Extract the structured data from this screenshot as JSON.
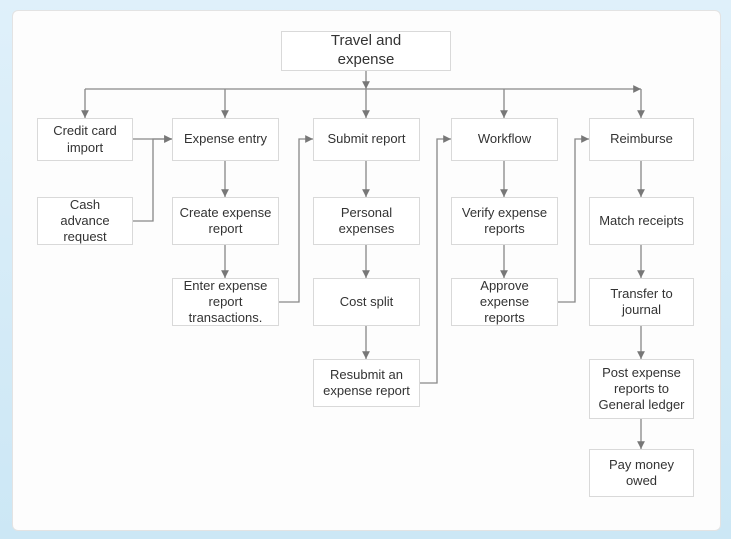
{
  "title": "Travel and expense",
  "row1": {
    "credit_card_import": "Credit card import",
    "expense_entry": "Expense entry",
    "submit_report": "Submit report",
    "workflow": "Workflow",
    "reimburse": "Reimburse"
  },
  "col1": {
    "cash_advance_request": "Cash advance request"
  },
  "col2": {
    "create_expense_report": "Create expense report",
    "enter_expense_transactions": "Enter expense report transactions."
  },
  "col3": {
    "personal_expenses": "Personal expenses",
    "cost_split": "Cost split",
    "resubmit": "Resubmit an expense report"
  },
  "col4": {
    "verify_expense_reports": "Verify expense reports",
    "approve_expense_reports": "Approve expense reports"
  },
  "col5": {
    "match_receipts": "Match receipts",
    "transfer_to_journal": "Transfer to journal",
    "post_to_gl": "Post expense reports to General ledger",
    "pay_money_owed": "Pay money owed"
  }
}
